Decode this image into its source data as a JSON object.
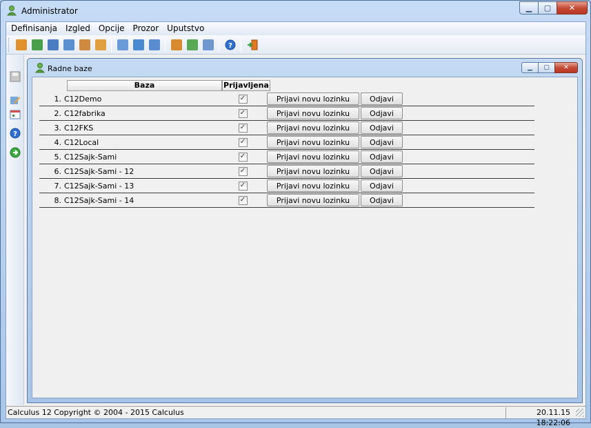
{
  "window": {
    "title": "Administrator"
  },
  "menu": [
    "Definisanja",
    "Izgled",
    "Opcije",
    "Prozor",
    "Uputstvo"
  ],
  "toolbar_icons": [
    {
      "name": "users-icon",
      "color": "#e0902c"
    },
    {
      "name": "add-table-icon",
      "color": "#4aa04a"
    },
    {
      "name": "table-icon",
      "color": "#4a7cc4"
    },
    {
      "name": "chart-window-icon",
      "color": "#5a90d0"
    },
    {
      "name": "user-group-icon",
      "color": "#d08a40"
    },
    {
      "name": "user-icon",
      "color": "#e0a040"
    },
    {
      "name": "edit-form-icon",
      "color": "#6a9ad8"
    },
    {
      "name": "check-form-icon",
      "color": "#4a8ad0"
    },
    {
      "name": "user-switch-icon",
      "color": "#5a8cd0"
    },
    {
      "name": "pencil-doc-icon",
      "color": "#d88a30"
    },
    {
      "name": "doc-check-icon",
      "color": "#58a858"
    },
    {
      "name": "copy-docs-icon",
      "color": "#6f98d0"
    },
    {
      "name": "help-icon",
      "color": "#2f6fd0"
    },
    {
      "name": "exit-icon",
      "color": "#e07a20"
    }
  ],
  "child_window": {
    "title": "Radne baze"
  },
  "table": {
    "headers": {
      "baza": "Baza",
      "prijavljena": "Prijavljena"
    },
    "rows": [
      {
        "num": "1.",
        "name": "C12Demo",
        "checked": "✓"
      },
      {
        "num": "2.",
        "name": "C12fabrika",
        "checked": "✓"
      },
      {
        "num": "3.",
        "name": "C12FKS",
        "checked": "✓"
      },
      {
        "num": "4.",
        "name": "C12Local",
        "checked": "✓"
      },
      {
        "num": "5.",
        "name": "C12Sajk-Sami",
        "checked": "✓"
      },
      {
        "num": "6.",
        "name": "C12Sajk-Sami - 12",
        "checked": "✓"
      },
      {
        "num": "7.",
        "name": "C12Sajk-Sami - 13",
        "checked": "✓"
      },
      {
        "num": "8.",
        "name": "C12Sajk-Sami - 14",
        "checked": "✓"
      }
    ],
    "login_label": "Prijavi novu lozinku",
    "logout_label": "Odjavi"
  },
  "status": {
    "left": "Calculus 12  Copyright © 2004 - 2015  Calculus",
    "right": "20.11.15 18:22:06"
  }
}
